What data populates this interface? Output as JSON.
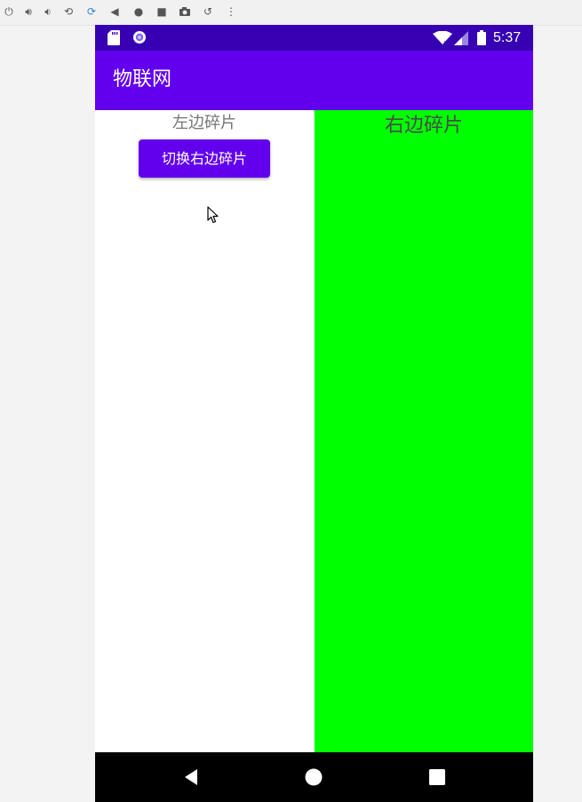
{
  "emulator_toolbar": {
    "icons": [
      "power-icon",
      "volume-up-icon",
      "volume-down-icon",
      "rotate-left-icon",
      "rotate-right-icon",
      "back-icon",
      "home-icon",
      "overview-icon",
      "camera-icon",
      "undo-icon",
      "more-icon"
    ]
  },
  "status_bar": {
    "time": "5:37",
    "icons": [
      "sd-card-icon",
      "notification-circle-icon",
      "wifi-icon",
      "signal-icon",
      "battery-icon"
    ],
    "color": "#3700b3"
  },
  "app_bar": {
    "title": "物联网",
    "color": "#6200ee"
  },
  "left_fragment": {
    "label": "左边碎片",
    "button_label": "切换右边碎片",
    "background": "#ffffff"
  },
  "right_fragment": {
    "label": "右边碎片",
    "background": "#00ff00"
  },
  "nav_bar": {
    "buttons": [
      "back-icon",
      "home-icon",
      "recents-icon"
    ]
  }
}
